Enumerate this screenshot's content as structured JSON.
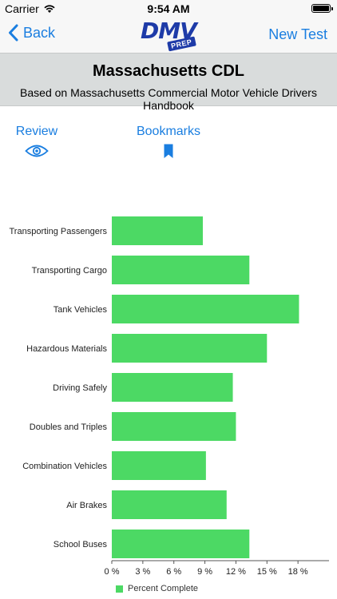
{
  "status_bar": {
    "carrier": "Carrier",
    "time": "9:54 AM"
  },
  "nav": {
    "back_label": "Back",
    "logo_text": "DMV",
    "logo_badge": "PREP",
    "new_test_label": "New Test"
  },
  "header": {
    "title": "Massachusetts CDL",
    "subtitle": "Based on Massachusetts Commercial Motor Vehicle Drivers Handbook"
  },
  "tabs": {
    "review_label": "Review",
    "bookmarks_label": "Bookmarks"
  },
  "colors": {
    "accent": "#1a7ee0",
    "bar": "#4cd964",
    "header_bg": "#d9dcdc"
  },
  "chart_data": {
    "type": "bar",
    "orientation": "horizontal",
    "categories": [
      "Transporting Passengers",
      "Transporting Cargo",
      "Tank Vehicles",
      "Hazardous Materials",
      "Driving Safely",
      "Doubles and Triples",
      "Combination Vehicles",
      "Air Brakes",
      "School Buses"
    ],
    "series": [
      {
        "name": "Percent Complete",
        "values": [
          8.8,
          13.3,
          18.1,
          15.0,
          11.7,
          12.0,
          9.1,
          11.1,
          13.3
        ]
      }
    ],
    "xticks": [
      "0 %",
      "3 %",
      "6 %",
      "9 %",
      "12 %",
      "15 %",
      "18 %"
    ],
    "xlim": [
      0,
      21
    ],
    "grid": false,
    "legend": "bottom-left"
  }
}
